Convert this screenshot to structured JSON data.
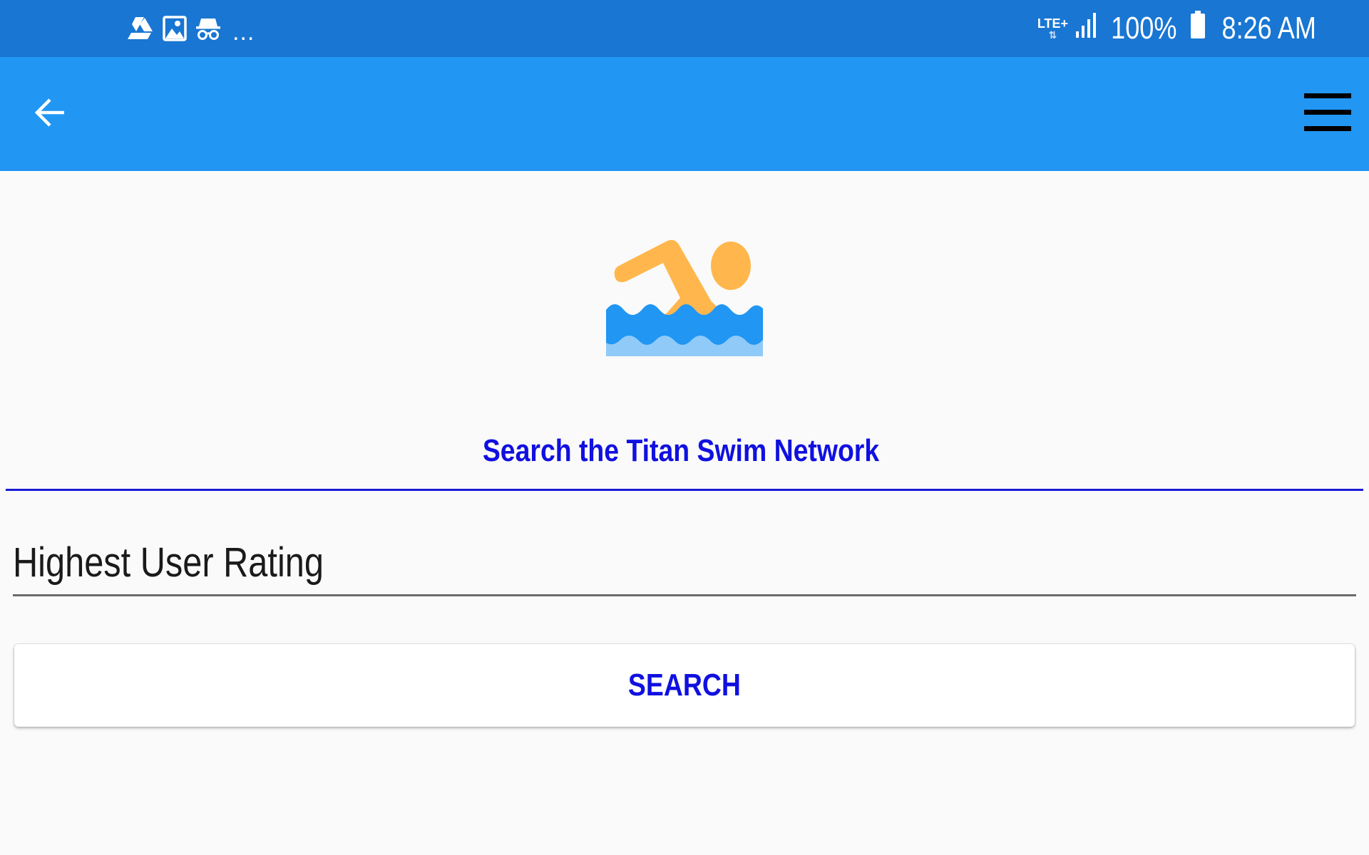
{
  "status_bar": {
    "left_icons": [
      "drive-icon",
      "image-icon",
      "incognito-icon"
    ],
    "more": "...",
    "network_label": "LTE+",
    "network_arrows": "⇅",
    "battery_percent": "100%",
    "time": "8:26 AM"
  },
  "app_bar": {
    "back_icon": "arrow-left-icon",
    "menu_icon": "hamburger-menu-icon"
  },
  "main": {
    "logo_icon": "swimmer-icon",
    "title": "Search the Titan Swim Network",
    "sort_field": {
      "value": "Highest User Rating"
    },
    "search_button_label": "SEARCH"
  },
  "colors": {
    "status_bar": "#1976d2",
    "app_bar": "#2196f3",
    "accent_text": "#1010e0",
    "background": "#fafafa",
    "swimmer": "#ffb74d",
    "water_dark": "#2196f3",
    "water_light": "#90caf9"
  }
}
